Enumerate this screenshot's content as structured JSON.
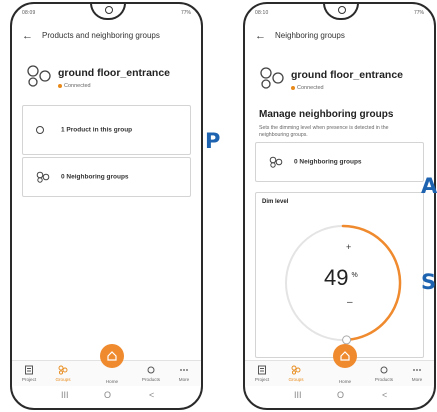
{
  "left_screen": {
    "status_time": "08:09",
    "status_right": "77%",
    "header_title": "Products and neighboring groups",
    "group_name": "ground floor_entrance",
    "group_status": "Connected",
    "cards": [
      {
        "label": "1 Product in this group",
        "icon": "bulb-icon"
      },
      {
        "label": "0 Neighboring groups",
        "icon": "neighbor-groups-icon"
      }
    ],
    "marker": "P"
  },
  "right_screen": {
    "status_time": "08:10",
    "status_right": "77%",
    "header_title": "Neighboring groups",
    "group_name": "ground floor_entrance",
    "group_status": "Connected",
    "manage_title": "Manage neighboring groups",
    "manage_description": "Sets the dimming level when presence is detected in the neighbouring groups.",
    "neighbor_card_label": "0 Neighboring groups",
    "dim_title": "Dim level",
    "dim_plus": "+",
    "dim_value": "49",
    "dim_unit": "%",
    "dim_minus": "–",
    "dim_level_percent": 49,
    "markers": [
      "A",
      "S"
    ]
  },
  "tabbar": {
    "tabs": [
      {
        "label": "Project",
        "icon": "project-icon"
      },
      {
        "label": "Groups",
        "icon": "groups-icon"
      },
      {
        "label": "Home",
        "icon": "home-icon"
      },
      {
        "label": "Products",
        "icon": "products-icon"
      },
      {
        "label": "More",
        "icon": "more-icon"
      }
    ],
    "active_tab": "Groups"
  },
  "navbar": {
    "recents": "III",
    "home": "O",
    "back": "<"
  },
  "colors": {
    "accent": "#f08a2e",
    "status_dot": "#e88a1a",
    "marker": "#1e63b0"
  }
}
